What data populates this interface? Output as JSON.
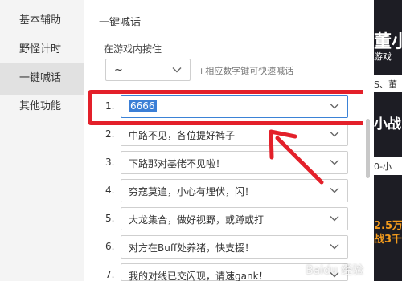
{
  "sidebar": {
    "items": [
      {
        "label": "基本辅助"
      },
      {
        "label": "野怪计时"
      },
      {
        "label": "一键喊话"
      },
      {
        "label": "其他功能"
      }
    ]
  },
  "main": {
    "title": "一键喊话",
    "hold_label": "在游戏内按住",
    "key_value": "~",
    "key_hint": "+相应数字键可快速喊话",
    "phrases": [
      {
        "num": "1.",
        "text": "6666"
      },
      {
        "num": "2.",
        "text": "中路不见，各位提好裤子"
      },
      {
        "num": "3.",
        "text": "下路那对基佬不见啦！"
      },
      {
        "num": "4.",
        "text": "穷寇莫追，小心有埋伏，闪！"
      },
      {
        "num": "5.",
        "text": "大龙集合，做好视野，或蹲或打"
      },
      {
        "num": "6.",
        "text": "对方在Buff处养猪，快支援！"
      },
      {
        "num": "7.",
        "text": "我的对线已交闪现，请速gank！"
      }
    ]
  },
  "ad": {
    "line1": "董小",
    "line2": "游戏",
    "line3": "S、董",
    "line4": "小战",
    "line5": "0-小",
    "line6": "2.5万",
    "line7": "战3千"
  },
  "watermark": "Baidu 经验",
  "colors": {
    "highlight": "#e3202a",
    "focus_border": "#3b82d6",
    "selection": "#3b7fd6"
  }
}
